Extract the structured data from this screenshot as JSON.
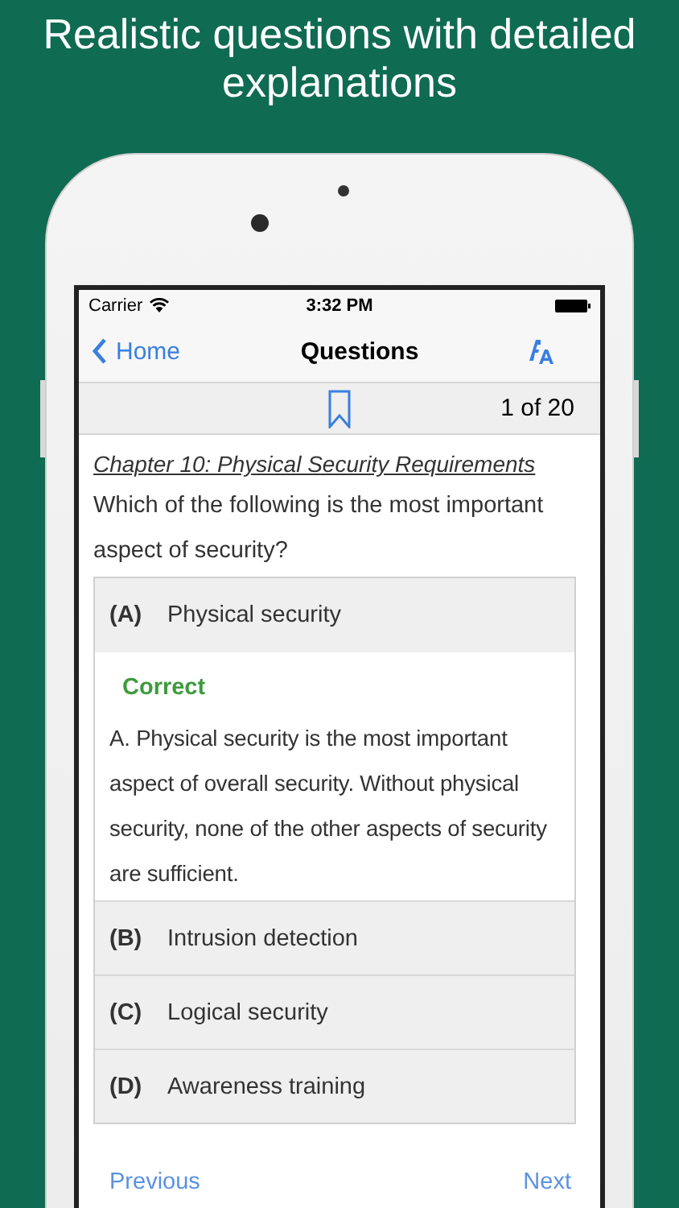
{
  "headline": "Realistic questions with detailed explanations",
  "status_bar": {
    "carrier": "Carrier",
    "time": "3:32 PM"
  },
  "nav": {
    "back": "Home",
    "title": "Questions"
  },
  "toolbar": {
    "counter": "1 of 20"
  },
  "chapter": "Chapter 10: Physical Security Requirements",
  "question": "Which of the following is the most important aspect of security?",
  "options": [
    {
      "letter": "(A)",
      "text": "Physical security",
      "result": "Correct",
      "explanation": "A. Physical security is the most important aspect of overall security. Without physical security, none of the other aspects of security are sufficient."
    },
    {
      "letter": "(B)",
      "text": "Intrusion detection"
    },
    {
      "letter": "(C)",
      "text": "Logical security"
    },
    {
      "letter": "(D)",
      "text": "Awareness training"
    }
  ],
  "footer": {
    "previous": "Previous",
    "next": "Next"
  }
}
